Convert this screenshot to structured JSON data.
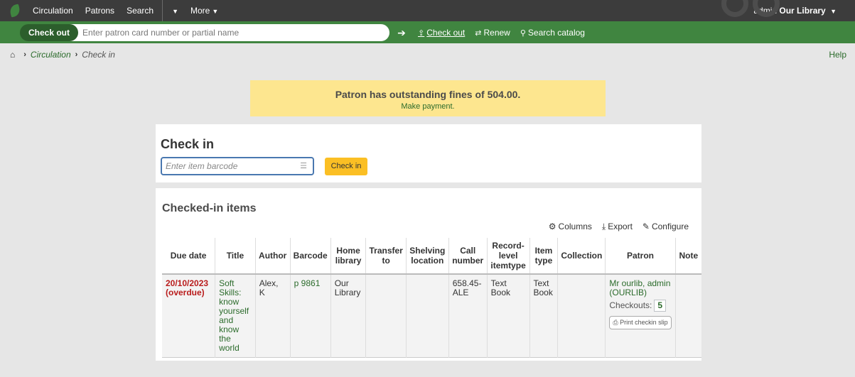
{
  "topnav": {
    "items": [
      "Circulation",
      "Patrons",
      "Search",
      "More"
    ],
    "user": "admin",
    "library": "Our Library"
  },
  "greenbar": {
    "tab": "Check out",
    "placeholder": "Enter patron card number or partial name",
    "links": [
      "Check out",
      "Renew",
      "Search catalog"
    ]
  },
  "breadcrumb": {
    "parent": "Circulation",
    "current": "Check in",
    "help": "Help"
  },
  "alert": {
    "message": "Patron has outstanding fines of 504.00.",
    "action": "Make payment."
  },
  "checkin": {
    "title": "Check in",
    "placeholder": "Enter item barcode",
    "button": "Check in"
  },
  "items": {
    "title": "Checked-in items",
    "toolbar": [
      "Columns",
      "Export",
      "Configure"
    ],
    "headers": [
      "Due date",
      "Title",
      "Author",
      "Barcode",
      "Home library",
      "Transfer to",
      "Shelving location",
      "Call number",
      "Record-level itemtype",
      "Item type",
      "Collection",
      "Patron",
      "Note"
    ],
    "row": {
      "due_date": "20/10/2023",
      "overdue": "(overdue)",
      "title": "Soft Skills: know yourself and know the world",
      "author": "Alex, K",
      "barcode": "p 9861",
      "home_library": "Our Library",
      "call_number": "658.45-ALE",
      "record_itemtype": "Text Book",
      "item_type": "Text Book",
      "patron": "Mr ourlib, admin (OURLIB)",
      "checkouts_label": "Checkouts:",
      "checkouts": "5",
      "print_slip": "Print checkin slip"
    }
  },
  "colors": {
    "topnav": "#3c3c3c",
    "greenbar": "#408540",
    "alert": "#fde68f",
    "button": "#fbbf24",
    "overdue": "#b91c1c"
  }
}
